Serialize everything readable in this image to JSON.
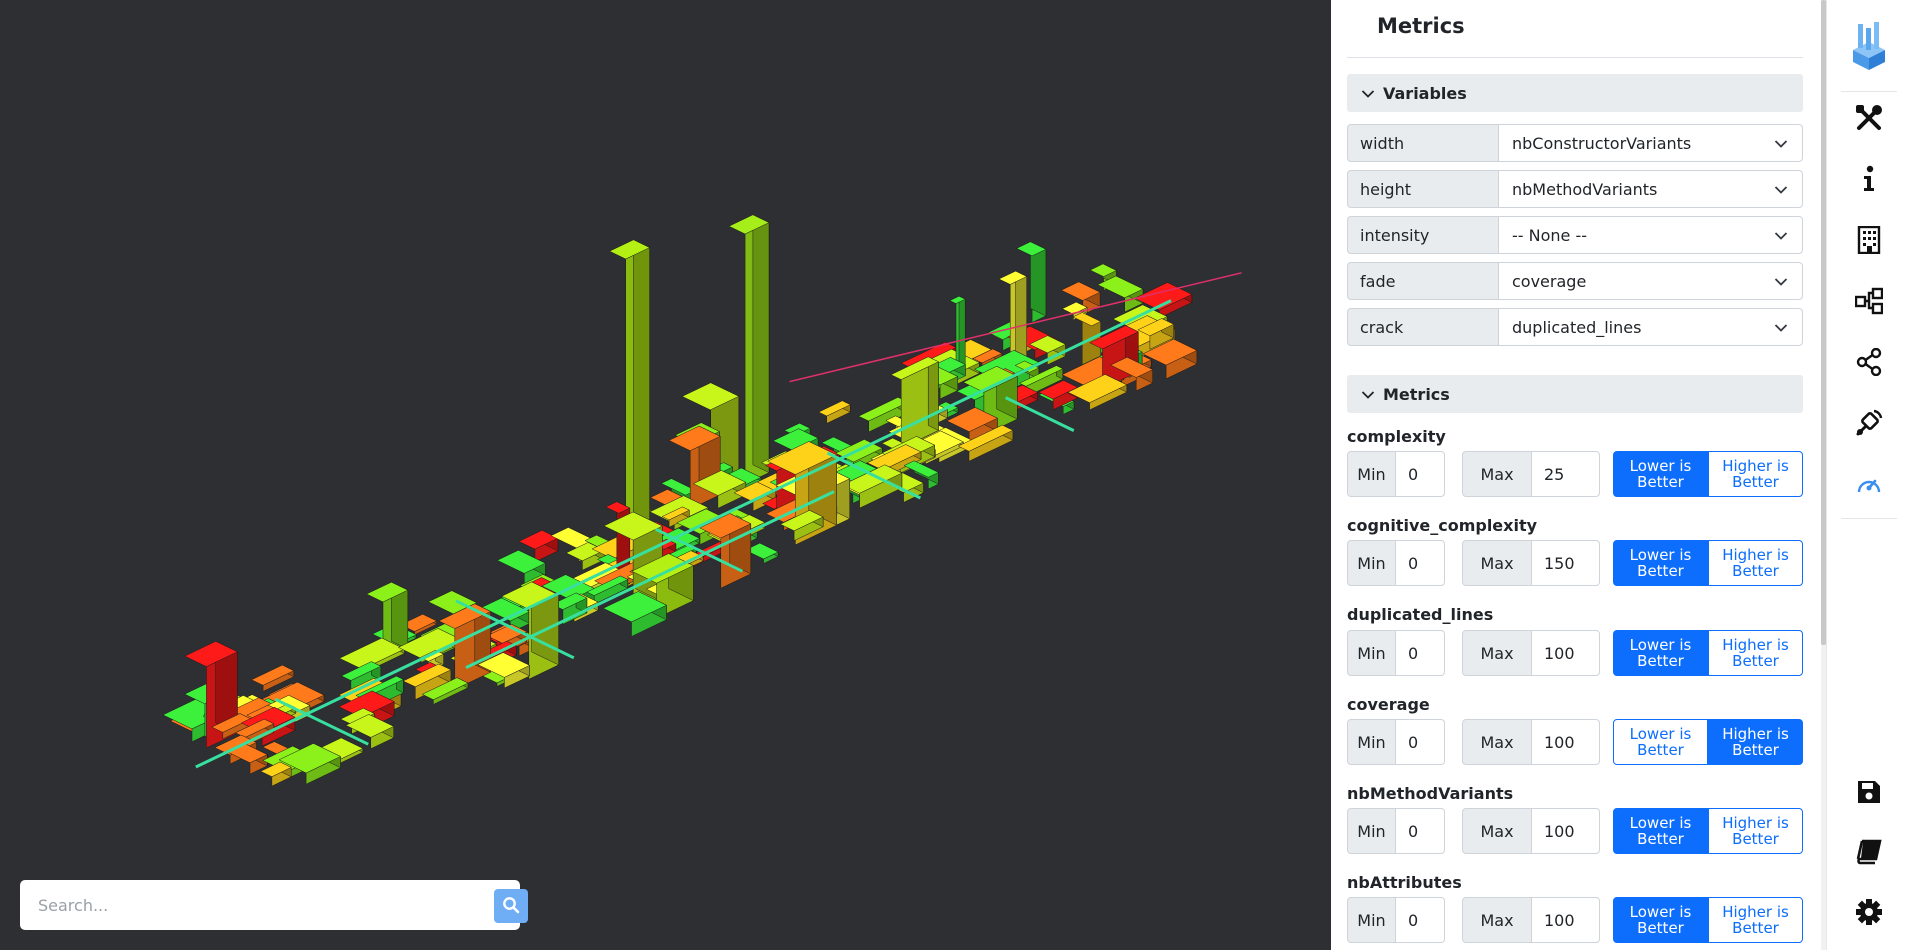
{
  "search": {
    "placeholder": "Search..."
  },
  "panel": {
    "title": "Metrics",
    "variables_header": "Variables",
    "variables": [
      {
        "label": "width",
        "value": "nbConstructorVariants"
      },
      {
        "label": "height",
        "value": "nbMethodVariants"
      },
      {
        "label": "intensity",
        "value": "-- None --"
      },
      {
        "label": "fade",
        "value": "coverage"
      },
      {
        "label": "crack",
        "value": "duplicated_lines"
      }
    ],
    "metrics_header": "Metrics",
    "min_label": "Min",
    "max_label": "Max",
    "lower_label": "Lower is Better",
    "higher_label": "Higher is Better",
    "metrics": [
      {
        "name": "complexity",
        "min": "0",
        "max": "25",
        "selected": "lower"
      },
      {
        "name": "cognitive_complexity",
        "min": "0",
        "max": "150",
        "selected": "lower"
      },
      {
        "name": "duplicated_lines",
        "min": "0",
        "max": "100",
        "selected": "lower"
      },
      {
        "name": "coverage",
        "min": "0",
        "max": "100",
        "selected": "higher"
      },
      {
        "name": "nbMethodVariants",
        "min": "0",
        "max": "100",
        "selected": "lower"
      },
      {
        "name": "nbAttributes",
        "min": "0",
        "max": "100",
        "selected": "lower"
      }
    ]
  },
  "rail": {
    "icons": [
      "logo-icon",
      "tools-icon",
      "info-icon",
      "building-icon",
      "hierarchy-icon",
      "share-icon",
      "satellite-icon",
      "dashboard-icon",
      "save-icon",
      "book-icon",
      "gear-icon"
    ],
    "active": "dashboard-icon"
  },
  "colors": {
    "accent": "#0d6efd",
    "viewport_bg": "#2e2f32",
    "district_road": "#38e0a0",
    "city_palette": [
      "#ff1a1a",
      "#ff7a1a",
      "#ffd21a",
      "#ffff33",
      "#c8f51a",
      "#8cf01a",
      "#3cf03c"
    ]
  }
}
